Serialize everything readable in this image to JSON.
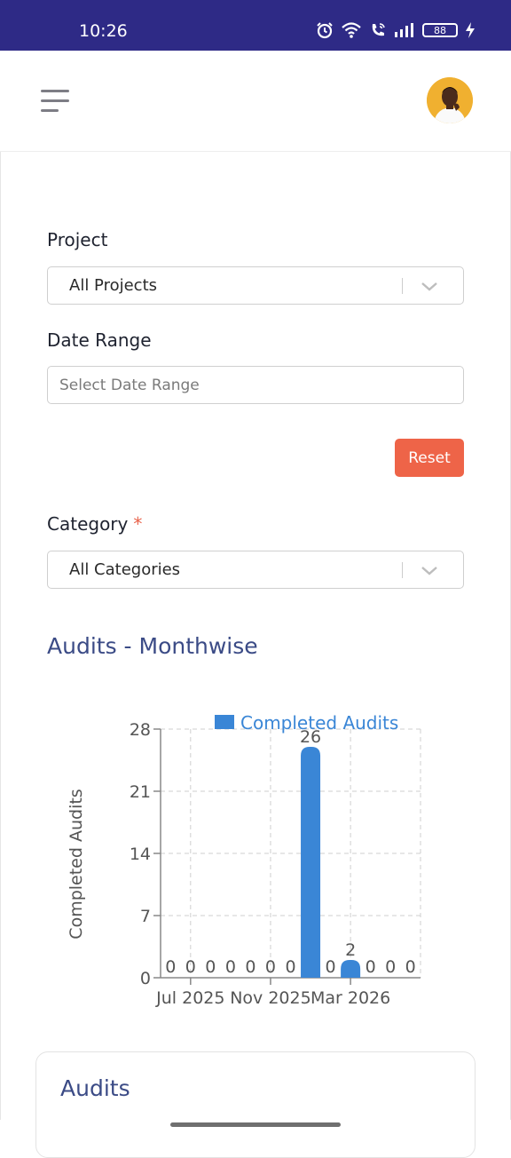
{
  "status_bar": {
    "time": "10:26",
    "battery": "88",
    "icons": [
      "alarm-icon",
      "wifi-icon",
      "call-icon",
      "signal-icon",
      "battery-icon",
      "charging-icon"
    ],
    "background": "#2e2a86"
  },
  "header": {
    "menu_icon": "hamburger-menu-icon",
    "avatar": "user-avatar"
  },
  "filters": {
    "project_label": "Project",
    "project_value": "All Projects",
    "date_label": "Date Range",
    "date_placeholder": "Select Date Range",
    "reset_label": "Reset",
    "category_label": "Category",
    "category_required": "*",
    "category_value": "All Categories"
  },
  "section": {
    "monthwise_title": "Audits - Monthwise"
  },
  "chart_data": {
    "type": "bar",
    "legend": "Completed Audits",
    "legend_position": "top",
    "ylabel": "Completed Audits",
    "ylim": [
      0,
      28
    ],
    "yticks": [
      "0",
      "7",
      "14",
      "21",
      "28"
    ],
    "xtick_labels": [
      "Jul 2025",
      "Nov 2025",
      "Mar 2026"
    ],
    "values": [
      0,
      0,
      0,
      0,
      0,
      0,
      0,
      26,
      0,
      2,
      0,
      0,
      0
    ],
    "value_labels": [
      "0",
      "0",
      "0",
      "0",
      "0",
      "0",
      "0",
      "26",
      "0",
      "2",
      "0",
      "0",
      "0"
    ],
    "grid": true,
    "bar_color": "#3a86d6"
  },
  "card": {
    "title": "Audits"
  },
  "colors": {
    "accent": "#3b4b86",
    "reset": "#ee6448",
    "required": "#e8624a"
  }
}
